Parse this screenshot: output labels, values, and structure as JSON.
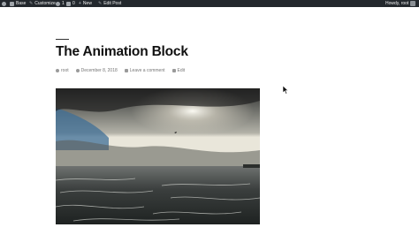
{
  "adminbar": {
    "site": "Base",
    "customize": "Customize",
    "updates_count": "1",
    "comments_count": "0",
    "new": "New",
    "edit_post": "Edit Post",
    "howdy": "Howdy, root"
  },
  "post": {
    "title": "The Animation Block",
    "author": "root",
    "date": "December 8, 2018",
    "comment_link": "Leave a comment",
    "edit_link": "Edit"
  },
  "colors": {
    "adminbar_bg": "#23282d",
    "meta_text": "#767676",
    "title": "#111111"
  }
}
